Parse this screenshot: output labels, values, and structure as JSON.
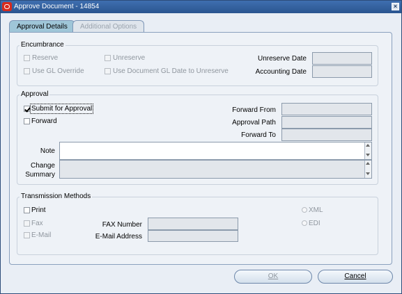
{
  "window": {
    "title": "Approve Document - 14854"
  },
  "tabs": [
    {
      "label": "Approval Details",
      "active": true
    },
    {
      "label": "Additional Options",
      "active": false
    }
  ],
  "encumbrance": {
    "title": "Encumbrance",
    "reserve": "Reserve",
    "unreserve": "Unreserve",
    "use_gl_override": "Use GL Override",
    "use_doc_gl_date": "Use Document GL Date to Unreserve",
    "unreserve_date_label": "Unreserve Date",
    "unreserve_date_value": "",
    "accounting_date_label": "Accounting Date",
    "accounting_date_value": ""
  },
  "approval": {
    "title": "Approval",
    "submit_for_approval": "Submit for Approval",
    "submit_checked": true,
    "forward": "Forward",
    "forward_checked": false,
    "forward_from_label": "Forward From",
    "forward_from_value": "",
    "approval_path_label": "Approval Path",
    "approval_path_value": "",
    "forward_to_label": "Forward To",
    "forward_to_value": "",
    "note_label": "Note",
    "note_value": "",
    "change_summary_label_1": "Change",
    "change_summary_label_2": "Summary",
    "change_summary_value": ""
  },
  "transmission": {
    "title": "Transmission Methods",
    "print": "Print",
    "fax": "Fax",
    "email": "E-Mail",
    "fax_number_label": "FAX Number",
    "fax_number_value": "",
    "email_address_label": "E-Mail Address",
    "email_address_value": "",
    "xml": "XML",
    "edi": "EDI"
  },
  "buttons": {
    "ok": "OK",
    "cancel": "Cancel"
  },
  "colors": {
    "title_bar": "#2a558f",
    "active_tab": "#9fc6d8",
    "background": "#e9eef5"
  }
}
